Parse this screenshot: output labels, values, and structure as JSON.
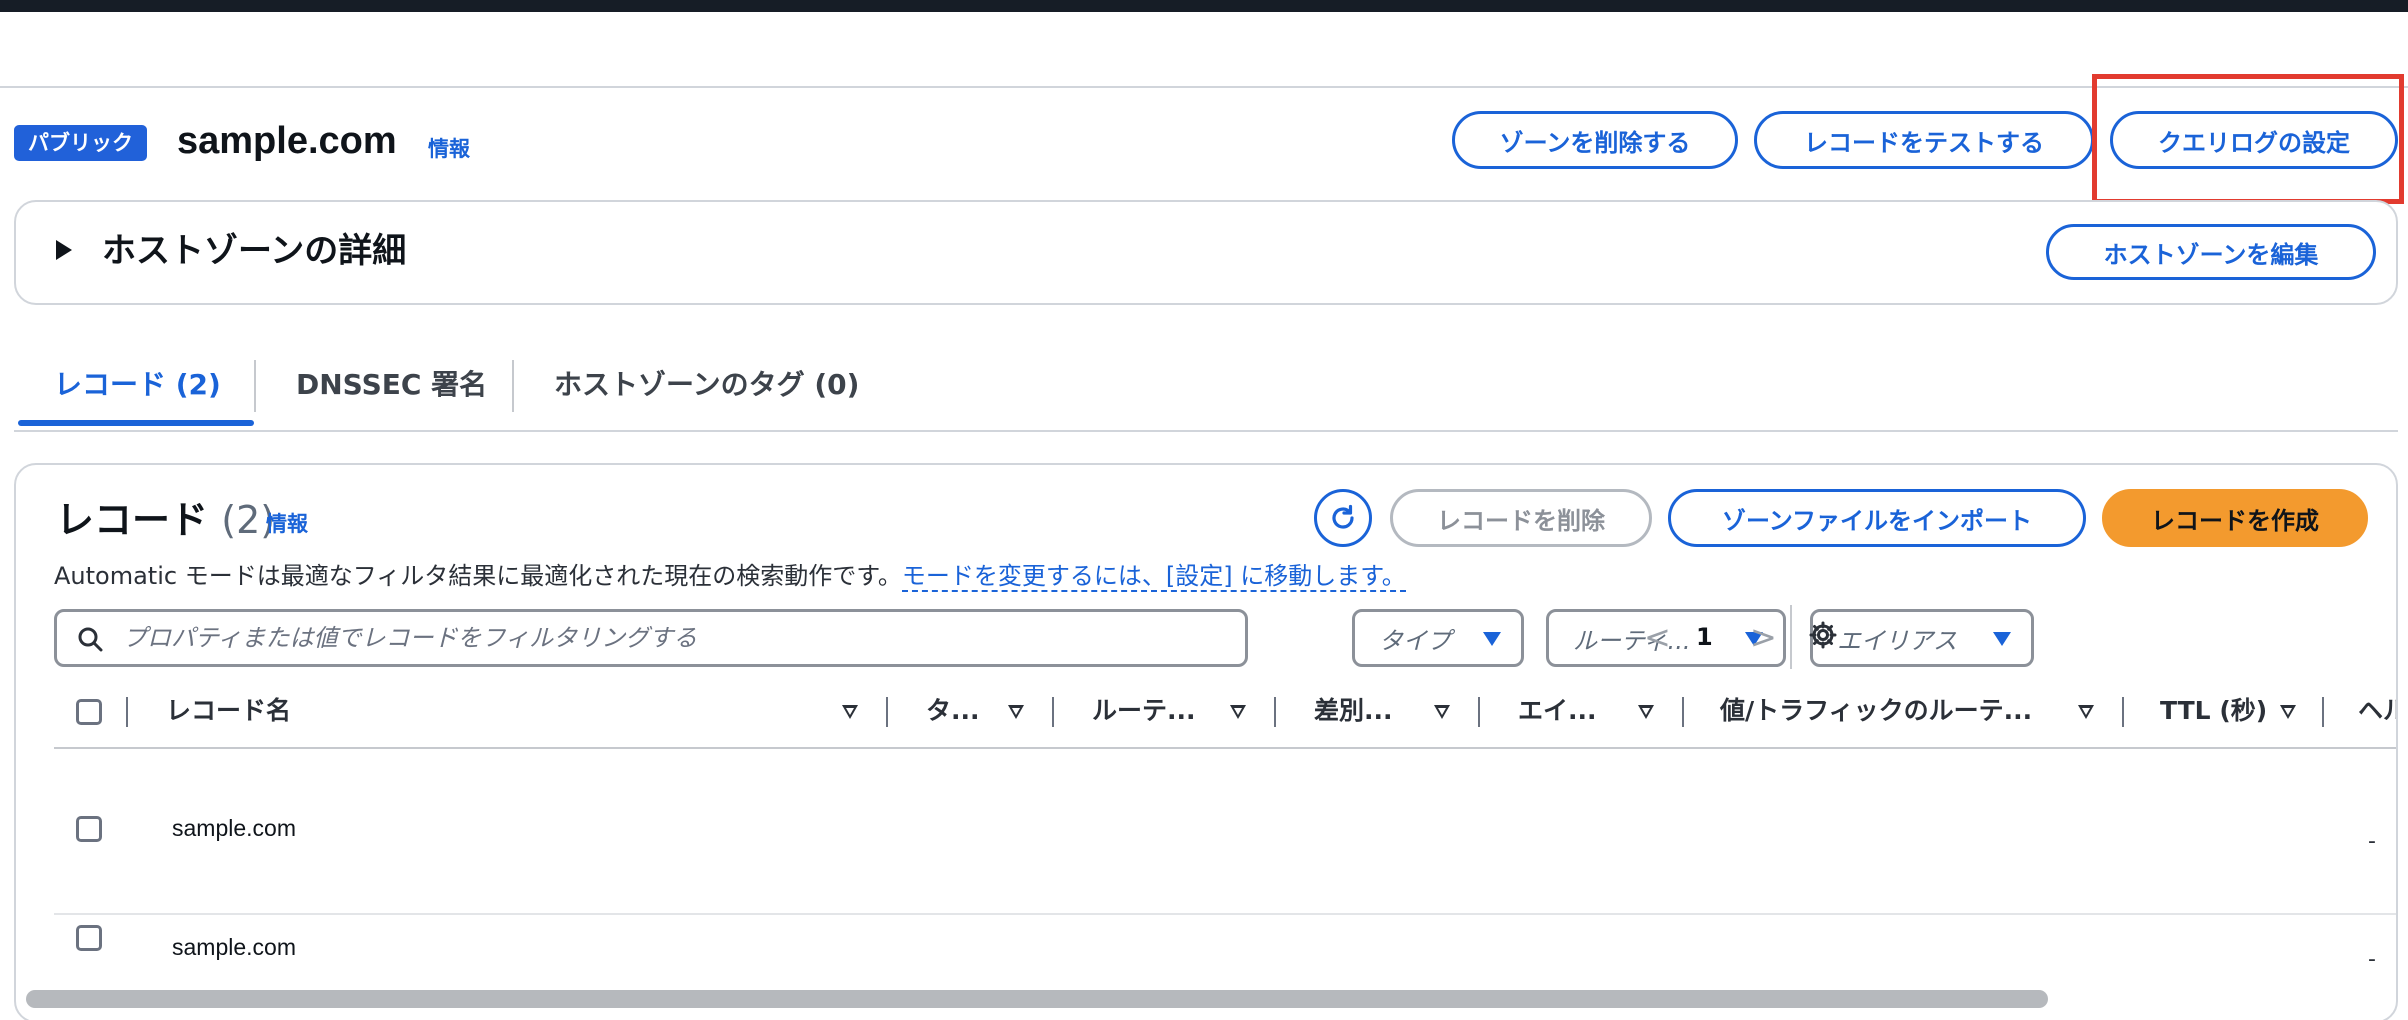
{
  "header": {
    "badge": "パブリック",
    "zone_name": "sample.com",
    "info": "情報",
    "buttons": {
      "delete_zone": "ゾーンを削除する",
      "test_record": "レコードをテストする",
      "query_log": "クエリログの設定"
    }
  },
  "details": {
    "title": "ホストゾーンの詳細",
    "edit_button": "ホストゾーンを編集"
  },
  "tabs": [
    {
      "label": "レコード (2)",
      "active": true
    },
    {
      "label": "DNSSEC 署名",
      "active": false
    },
    {
      "label": "ホストゾーンのタグ (0)",
      "active": false
    }
  ],
  "records": {
    "title": "レコード",
    "count": "(2)",
    "info": "情報",
    "mode_text": "Automatic モードは最適なフィルタ結果に最適化された現在の検索動作です。",
    "mode_link": "モードを変更するには、[設定] に移動します。",
    "buttons": {
      "delete": "レコードを削除",
      "import": "ゾーンファイルをインポート",
      "create": "レコードを作成"
    },
    "search_placeholder": "プロパティまたは値でレコードをフィルタリングする",
    "filters": {
      "type": "タイプ",
      "routing": "ルーティ...",
      "alias": "エイリアス"
    },
    "pager": {
      "prev": "<",
      "page": "1",
      "next": ">"
    },
    "columns": {
      "name": "レコード名",
      "type": "タ...",
      "routing": "ルーテ...",
      "differentiator": "差別...",
      "alias": "エイ...",
      "value": "値/トラフィックのルーテ...",
      "ttl": "TTL (秒)",
      "health": "ヘル"
    },
    "rows": [
      {
        "name": "sample.com",
        "ttl": "-"
      },
      {
        "name": "sample.com",
        "ttl": "-"
      }
    ]
  },
  "colors": {
    "accent": "#1a63d8",
    "primary_button": "#f39a2e",
    "highlight": "#e23b2f",
    "topbar": "#161d26"
  }
}
